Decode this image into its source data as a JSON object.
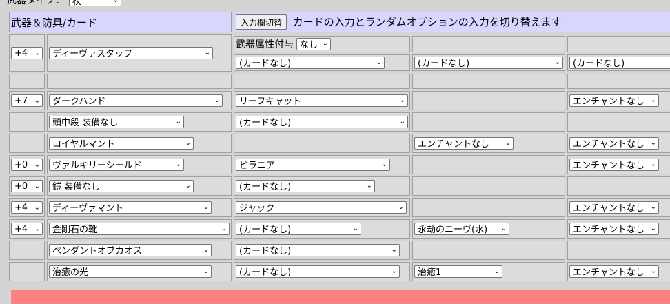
{
  "top": {
    "label": "武器タイプ：",
    "select_value": "杖"
  },
  "header": {
    "title": "武器＆防具/カード",
    "toggle_button": "入力欄切替",
    "toggle_desc": "カードの入力とランダムオプションの入力を切り替えます"
  },
  "weapon": {
    "refine": "+4",
    "name": "ディーヴァスタッフ",
    "attr_label": "武器属性付与",
    "attr_value": "なし",
    "cards": [
      "(カードなし)",
      "(カードなし)",
      "(カードなし)"
    ]
  },
  "rows": [
    {
      "refine": "+7",
      "item": "ダークハンド",
      "card": "リーフキャット",
      "slot3": "",
      "slot4": "エンチャントなし"
    },
    {
      "refine": "",
      "item": "頭中段 装備なし",
      "card": "(カードなし)",
      "slot3": "",
      "slot4": ""
    },
    {
      "refine": "",
      "item": "ロイヤルマント",
      "card": "",
      "slot3": "エンチャントなし",
      "slot4": "エンチャントなし"
    },
    {
      "refine": "+0",
      "item": "ヴァルキリーシールド",
      "card": "ピラニア",
      "slot3": "",
      "slot4": "エンチャントなし"
    },
    {
      "refine": "+0",
      "item": "鎧 装備なし",
      "card": "(カードなし)",
      "slot3": "",
      "slot4": ""
    },
    {
      "refine": "+4",
      "item": "ディーヴァマント",
      "card": "ジャック",
      "slot3": "",
      "slot4": "エンチャントなし"
    },
    {
      "refine": "+4",
      "item": "金剛石の靴",
      "card": "(カードなし)",
      "slot3": "永劫のニーヴ(水)",
      "slot4": "エンチャントなし"
    },
    {
      "refine": "",
      "item": "ペンダントオブカオス",
      "card": "(カードなし)",
      "slot3": "",
      "slot4": ""
    },
    {
      "refine": "",
      "item": "治癒の光",
      "card": "(カードなし)",
      "slot3": "治癒1",
      "slot4": "エンチャントなし"
    }
  ]
}
